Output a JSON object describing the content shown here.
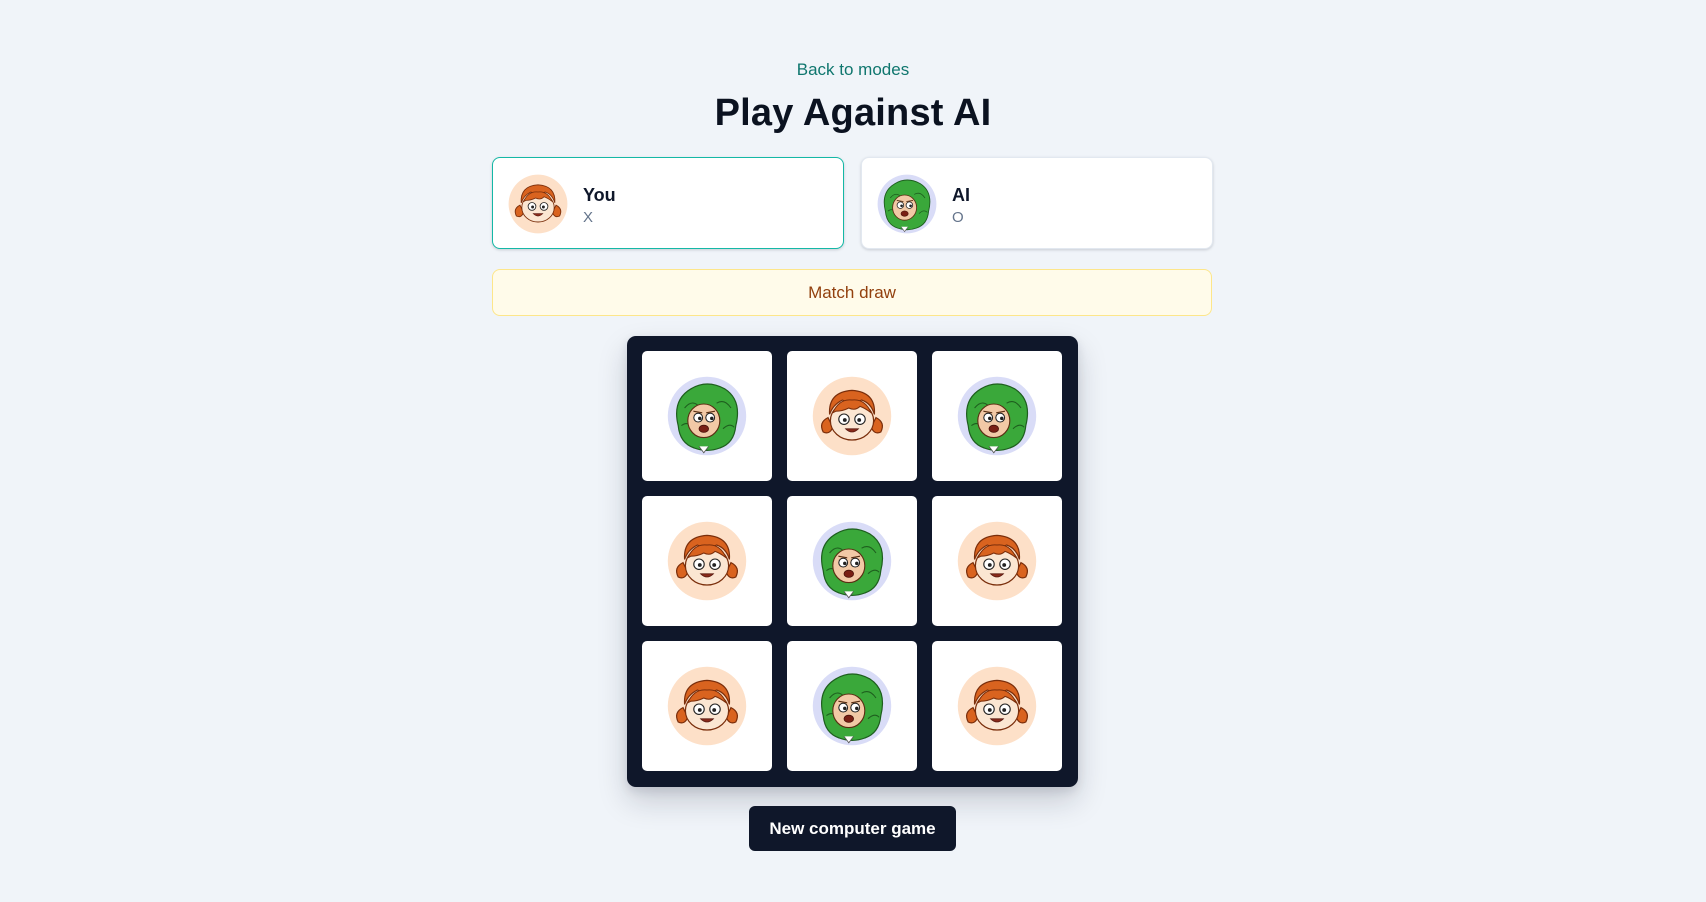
{
  "nav": {
    "back_label": "Back to modes"
  },
  "header": {
    "title": "Play Against AI"
  },
  "players": [
    {
      "name": "You",
      "symbol": "X",
      "avatar_icon": "orange-hair-face-icon",
      "active": true
    },
    {
      "name": "AI",
      "symbol": "O",
      "avatar_icon": "green-hair-face-icon",
      "active": false
    }
  ],
  "status": {
    "text": "Match draw"
  },
  "board": {
    "cells": [
      "O",
      "X",
      "O",
      "X",
      "O",
      "X",
      "X",
      "O",
      "X"
    ]
  },
  "actions": {
    "new_game_label": "New computer game"
  },
  "colors": {
    "background": "#f0f4f9",
    "accent": "#14b8a6",
    "link": "#0f766e",
    "board": "#0f172a",
    "banner_bg": "#fffbea",
    "banner_text": "#92400e",
    "x_avatar_bg": "#fde0c8",
    "o_avatar_bg": "#d9dcf7"
  }
}
